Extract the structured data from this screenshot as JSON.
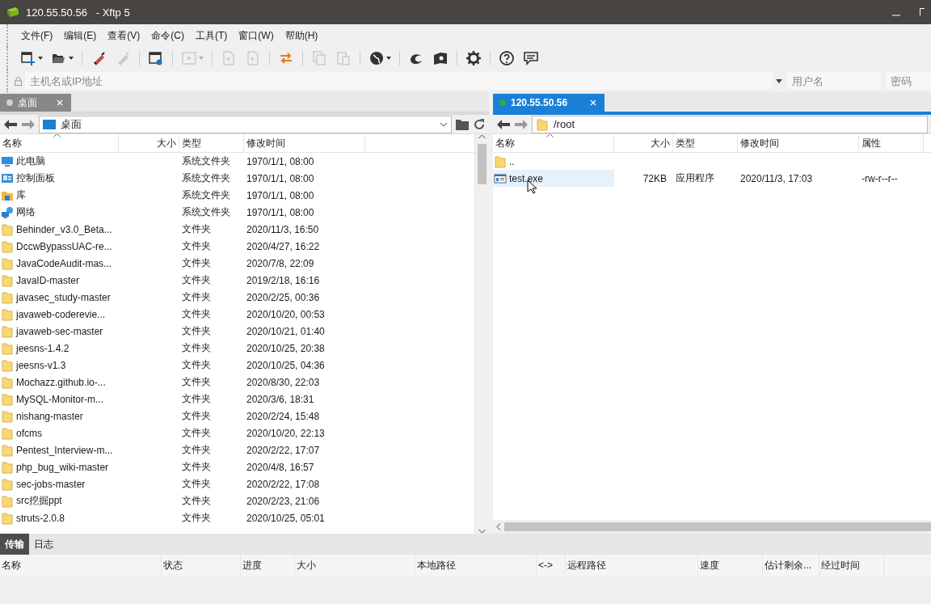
{
  "window": {
    "title": "120.55.50.56   - Xftp 5"
  },
  "menu": [
    "文件(F)",
    "编辑(E)",
    "查看(V)",
    "命令(C)",
    "工具(T)",
    "窗口(W)",
    "帮助(H)"
  ],
  "toolbar": [
    {
      "kind": "new-session",
      "disabled": false
    },
    {
      "kind": "open-folder",
      "disabled": false
    },
    {
      "kind": "connect",
      "disabled": false
    },
    {
      "kind": "disconnect",
      "disabled": true
    },
    {
      "kind": "session-settings",
      "disabled": false
    },
    {
      "kind": "play",
      "disabled": true
    },
    {
      "kind": "upload",
      "disabled": true
    },
    {
      "kind": "download",
      "disabled": true
    },
    {
      "kind": "swap",
      "disabled": false
    },
    {
      "kind": "copy",
      "disabled": true
    },
    {
      "kind": "paste",
      "disabled": true
    },
    {
      "kind": "globe",
      "disabled": false
    },
    {
      "kind": "shell",
      "disabled": false
    },
    {
      "kind": "book",
      "disabled": false
    },
    {
      "kind": "settings",
      "disabled": false
    },
    {
      "kind": "help",
      "disabled": false
    },
    {
      "kind": "feedback",
      "disabled": false
    }
  ],
  "address": {
    "host_placeholder": "主机名或IP地址",
    "user_placeholder": "用户名",
    "password_placeholder": "密码"
  },
  "panes": [
    {
      "tab": {
        "label": "桌面",
        "connected": false,
        "selected": false
      },
      "path": {
        "text": "桌面",
        "kind": "desktop"
      },
      "columns": [
        {
          "label": "名称",
          "sorted": true
        },
        {
          "label": "大小",
          "sorted": false
        },
        {
          "label": "类型",
          "sorted": false
        },
        {
          "label": "修改时间",
          "sorted": false
        }
      ],
      "rows": [
        {
          "kind": "computer",
          "name": "此电脑",
          "size": "",
          "type": "系统文件夹",
          "mtime": "1970/1/1, 08:00",
          "selected": false
        },
        {
          "kind": "control-panel",
          "name": "控制面板",
          "size": "",
          "type": "系统文件夹",
          "mtime": "1970/1/1, 08:00",
          "selected": false
        },
        {
          "kind": "library",
          "name": "库",
          "size": "",
          "type": "系统文件夹",
          "mtime": "1970/1/1, 08:00",
          "selected": false
        },
        {
          "kind": "network",
          "name": "网络",
          "size": "",
          "type": "系统文件夹",
          "mtime": "1970/1/1, 08:00",
          "selected": false
        },
        {
          "kind": "folder",
          "name": "Behinder_v3.0_Beta...",
          "size": "",
          "type": "文件夹",
          "mtime": "2020/11/3, 16:50",
          "selected": false
        },
        {
          "kind": "folder",
          "name": "DccwBypassUAC-re...",
          "size": "",
          "type": "文件夹",
          "mtime": "2020/4/27, 16:22",
          "selected": false
        },
        {
          "kind": "folder",
          "name": "JavaCodeAudit-mas...",
          "size": "",
          "type": "文件夹",
          "mtime": "2020/7/8, 22:09",
          "selected": false
        },
        {
          "kind": "folder",
          "name": "JavaID-master",
          "size": "",
          "type": "文件夹",
          "mtime": "2019/2/18, 16:16",
          "selected": false
        },
        {
          "kind": "folder",
          "name": "javasec_study-master",
          "size": "",
          "type": "文件夹",
          "mtime": "2020/2/25, 00:36",
          "selected": false
        },
        {
          "kind": "folder",
          "name": "javaweb-coderevie...",
          "size": "",
          "type": "文件夹",
          "mtime": "2020/10/20, 00:53",
          "selected": false
        },
        {
          "kind": "folder",
          "name": "javaweb-sec-master",
          "size": "",
          "type": "文件夹",
          "mtime": "2020/10/21, 01:40",
          "selected": false
        },
        {
          "kind": "folder",
          "name": "jeesns-1.4.2",
          "size": "",
          "type": "文件夹",
          "mtime": "2020/10/25, 20:38",
          "selected": false
        },
        {
          "kind": "folder",
          "name": "jeesns-v1.3",
          "size": "",
          "type": "文件夹",
          "mtime": "2020/10/25, 04:36",
          "selected": false
        },
        {
          "kind": "folder",
          "name": "Mochazz.github.io-...",
          "size": "",
          "type": "文件夹",
          "mtime": "2020/8/30, 22:03",
          "selected": false
        },
        {
          "kind": "folder",
          "name": "MySQL-Monitor-m...",
          "size": "",
          "type": "文件夹",
          "mtime": "2020/3/6, 18:31",
          "selected": false
        },
        {
          "kind": "folder",
          "name": "nishang-master",
          "size": "",
          "type": "文件夹",
          "mtime": "2020/2/24, 15:48",
          "selected": false
        },
        {
          "kind": "folder",
          "name": "ofcms",
          "size": "",
          "type": "文件夹",
          "mtime": "2020/10/20, 22:13",
          "selected": false
        },
        {
          "kind": "folder",
          "name": "Pentest_Interview-m...",
          "size": "",
          "type": "文件夹",
          "mtime": "2020/2/22, 17:07",
          "selected": false
        },
        {
          "kind": "folder",
          "name": "php_bug_wiki-master",
          "size": "",
          "type": "文件夹",
          "mtime": "2020/4/8, 16:57",
          "selected": false
        },
        {
          "kind": "folder",
          "name": "sec-jobs-master",
          "size": "",
          "type": "文件夹",
          "mtime": "2020/2/22, 17:08",
          "selected": false
        },
        {
          "kind": "folder",
          "name": "src挖掘ppt",
          "size": "",
          "type": "文件夹",
          "mtime": "2020/2/23, 21:06",
          "selected": false
        },
        {
          "kind": "folder",
          "name": "struts-2.0.8",
          "size": "",
          "type": "文件夹",
          "mtime": "2020/10/25, 05:01",
          "selected": false
        }
      ]
    },
    {
      "tab": {
        "label": "120.55.50.56",
        "connected": true,
        "selected": true
      },
      "path": {
        "text": "/root",
        "kind": "folder"
      },
      "columns": [
        {
          "label": "名称",
          "sorted": true
        },
        {
          "label": "大小",
          "sorted": false
        },
        {
          "label": "类型",
          "sorted": false
        },
        {
          "label": "修改时间",
          "sorted": false
        },
        {
          "label": "属性",
          "sorted": false
        }
      ],
      "rows": [
        {
          "kind": "folder",
          "name": "..",
          "size": "",
          "type": "",
          "mtime": "",
          "attr": "",
          "selected": false
        },
        {
          "kind": "exe",
          "name": "test.exe",
          "size": "72KB",
          "type": "应用程序",
          "mtime": "2020/11/3, 17:03",
          "attr": "-rw-r--r--",
          "selected": true
        }
      ]
    }
  ],
  "bottom": {
    "tabs": [
      {
        "label": "传输",
        "selected": true
      },
      {
        "label": "日志",
        "selected": false
      }
    ],
    "columns": [
      "名称",
      "状态",
      "进度",
      "大小",
      "本地路径",
      "<->",
      "远程路径",
      "速度",
      "估计剩余...",
      "经过时间"
    ]
  }
}
